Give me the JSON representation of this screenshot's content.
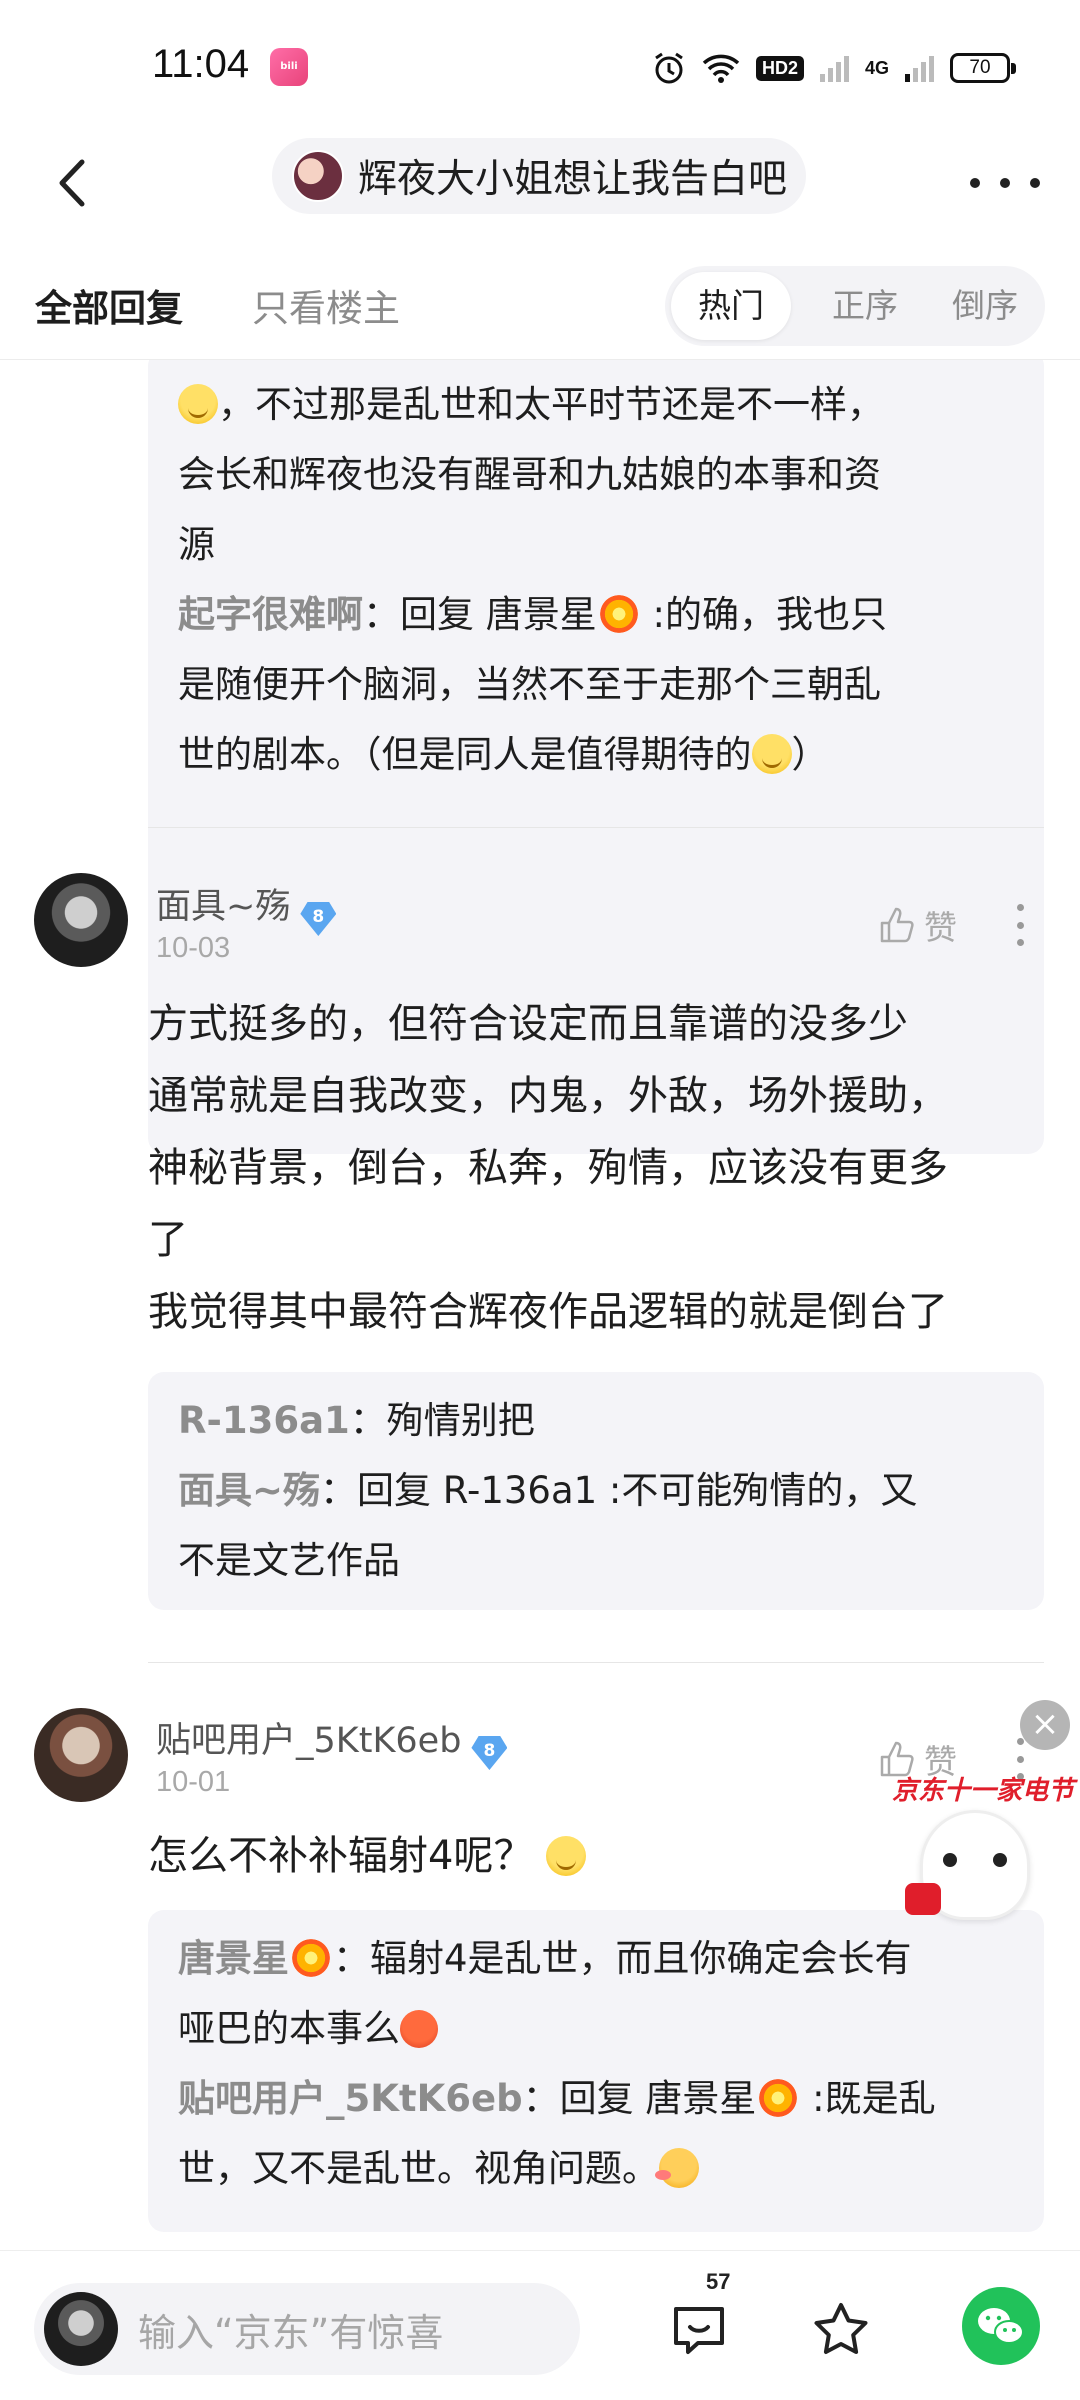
{
  "status_bar": {
    "time": "11:04",
    "app_icon": "bilibili",
    "hd_label": "HD2",
    "network_label": "4G",
    "battery": "70"
  },
  "nav": {
    "title": "辉夜大小姐想让我告白吧"
  },
  "filters": {
    "all": "全部回复",
    "host_only": "只看楼主",
    "sort": [
      "热门",
      "正序",
      "倒序"
    ]
  },
  "quote1": {
    "lines": [
      "，不过那是乱世和太平时节还是不一样，",
      "会长和辉夜也没有醒哥和九姑娘的本事和资",
      "源"
    ],
    "reply_name": "起字很难啊",
    "reply_prefix": "：回复 唐景星",
    "reply_line1_rest": " :的确，我也只",
    "reply_line2": "是随便开个脑洞，当然不至于走那个三朝乱",
    "reply_line3": "世的剧本。（但是同人是值得期待的",
    "reply_line3_end": "）"
  },
  "post1": {
    "name": "面具~殇",
    "level": "8",
    "date": "10-03",
    "like_label": "赞",
    "body": [
      "方式挺多的，但符合设定而且靠谱的没多少",
      "通常就是自我改变，内鬼，外敌，场外援助，",
      "神秘背景，倒台，私奔，殉情，应该没有更多",
      "了",
      "我觉得其中最符合辉夜作品逻辑的就是倒台了"
    ],
    "replies": {
      "r1_name": "R-136a1",
      "r1_text": "：殉情别把",
      "r2_name": "面具~殇",
      "r2_text": "：回复 R-136a1 :不可能殉情的，又",
      "r2_text2": "不是文艺作品"
    }
  },
  "post2": {
    "name": "贴吧用户_5KtK6eb",
    "level": "8",
    "date": "10-01",
    "like_label": "赞",
    "body": "怎么不补补辐射4呢？",
    "replies": {
      "r1_name": "唐景星",
      "r1_text": "：辐射4是乱世，而且你确定会长有",
      "r1_text2": "哑巴的本事么",
      "r2_name": "贴吧用户_5KtK6eb",
      "r2_text": "：回复 唐景星",
      "r2_text_rest": " :既是乱",
      "r2_text2": "世，又不是乱世。视角问题。"
    }
  },
  "ad": {
    "close": "×",
    "text": "京东十一家电节"
  },
  "bottom": {
    "placeholder": "输入“京东”有惊喜",
    "comment_count": "57"
  }
}
